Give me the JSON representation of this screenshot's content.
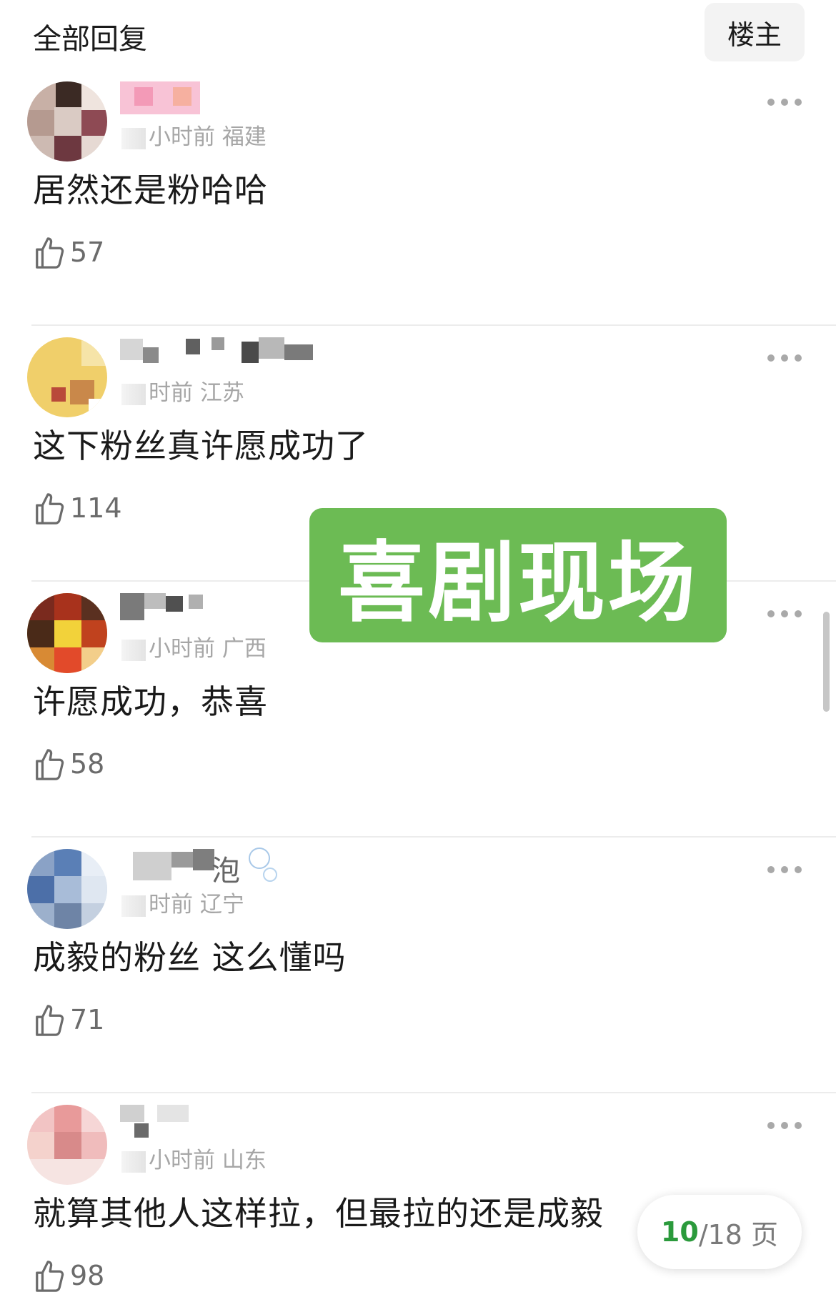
{
  "header": {
    "title": "全部回复",
    "filter_label": "楼主"
  },
  "comments": [
    {
      "time_location": "小时前 福建",
      "text": "居然还是粉哈哈",
      "likes": "57"
    },
    {
      "time_location": "时前 江苏",
      "text": "这下粉丝真许愿成功了",
      "likes": "114"
    },
    {
      "time_location": "小时前 广西",
      "text": "许愿成功，恭喜",
      "likes": "58"
    },
    {
      "username_fragment": "泡",
      "time_location": "时前 辽宁",
      "text": "成毅的粉丝 这么懂吗",
      "likes": "71"
    },
    {
      "time_location": "小时前 山东",
      "text": "就算其他人这样拉，但最拉的还是成毅",
      "likes": "98"
    }
  ],
  "watermark": {
    "text": "喜剧现场",
    "color": "#6cbb54"
  },
  "pager": {
    "current": "10",
    "total": "/18 页"
  },
  "colors": {
    "accent_green": "#2b9a3c",
    "meta_gray": "#a6a6a6"
  },
  "icons": {
    "like": "thumbs-up-icon",
    "more": "more-dots-icon"
  }
}
